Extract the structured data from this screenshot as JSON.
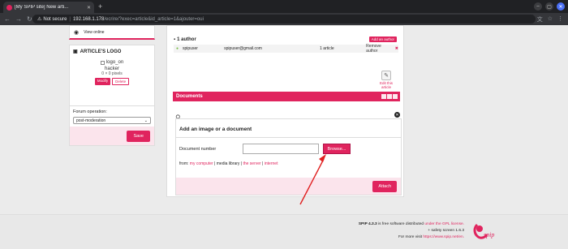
{
  "browser": {
    "tab_title": "[My SPIP site] New arti...",
    "new_tab": "+",
    "security": "Not secure",
    "url_host": "192.168.1.178",
    "url_path": "/ecrire/?exec=article&id_article=1&ajouter=oui",
    "win_minimize": "–",
    "win_maximize": "▢",
    "win_close": "✕"
  },
  "sidebar": {
    "view_online": "View online",
    "logo_title": "ARTICLE'S LOGO",
    "logo_alt": "logo_on",
    "logo_name": "hacker",
    "logo_size": "0 × 0 pixels",
    "modify": "Modify",
    "delete": "Delete",
    "forum_label": "Forum operation:",
    "forum_value": "post-moderation",
    "save": "Save"
  },
  "authors": {
    "header": "1 author",
    "add": "Add an author",
    "name": "spipuser",
    "email": "spipuser@gmail.com",
    "articles": "1 article",
    "remove": "Remove author"
  },
  "edit_article": "Edit this article",
  "documents": {
    "title": "Documents",
    "upload_title": "Add an image or a document",
    "doc_number_label": "Document number",
    "browse": "Browse...",
    "from_label": "from:",
    "from_my_computer": "my computer",
    "from_media_library": "media library",
    "from_server": "the server",
    "from_internet": "internet",
    "attach": "Attach"
  },
  "footer": {
    "line1_a": "SPIP 4.3.3",
    "line1_b": " is free software distributed ",
    "line1_link": "under the GPL license.",
    "line2": "+ safety screen 1.6.3",
    "line3_a": "For more visit ",
    "line3_link": "https://www.spip.net/en.",
    "logo_text": "spip"
  },
  "colors": {
    "accent": "#e0245e",
    "panel_pink": "#fbe4ec"
  }
}
